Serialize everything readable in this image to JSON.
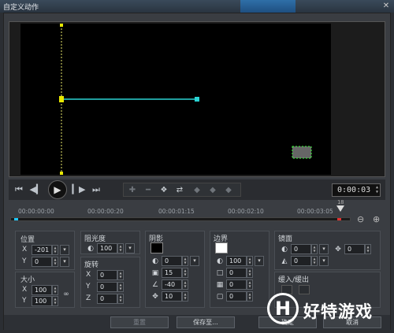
{
  "window": {
    "title": "自定义动作",
    "close_label": "✕"
  },
  "transport": {
    "icons": [
      "go-start-icon",
      "prev-frame-icon",
      "play-icon",
      "next-frame-icon",
      "go-end-icon"
    ],
    "glyphs": {
      "start": "⏮",
      "prev": "◀▎",
      "play": "▶",
      "next": "▎▶",
      "end": "⏭"
    }
  },
  "keyframes": {
    "glyphs": [
      "✚",
      "━",
      "❖",
      "⇄",
      "◆",
      "◆",
      "◆"
    ]
  },
  "timecode": {
    "value": "0:00:03",
    "frame": "18"
  },
  "ruler": {
    "ticks": [
      "00:00:00:00",
      "00:00:00:20",
      "00:00:01:15",
      "00:00:02:10",
      "00:00:03:05"
    ],
    "zoom_out": "⊖",
    "zoom_in": "⊕"
  },
  "position": {
    "label": "位置",
    "x_label": "X",
    "x": "-201",
    "y_label": "Y",
    "y": "0"
  },
  "size": {
    "label": "大小",
    "x_label": "X",
    "x": "100",
    "y_label": "Y",
    "y": "100",
    "link_icon": "∞"
  },
  "opacity": {
    "label": "阻光度",
    "value": "100"
  },
  "rotation": {
    "label": "旋转",
    "x_label": "X",
    "x": "0",
    "y_label": "Y",
    "y": "0",
    "z_label": "Z",
    "z": "0"
  },
  "shadow": {
    "label": "阴影",
    "color": "#000000",
    "v1": "0",
    "v2": "15",
    "v3": "-40",
    "v4": "10"
  },
  "border": {
    "label": "边界",
    "color": "#ffffff",
    "v1": "100",
    "v2": "0",
    "v3": "0",
    "v4": "0"
  },
  "mirror": {
    "label": "镜面",
    "v1": "0",
    "v2": "0",
    "v3": "0"
  },
  "fade": {
    "label": "缓入/缓出"
  },
  "buttons": {
    "reset": "重置",
    "save_to": "保存至...",
    "ok": "确定",
    "cancel": "取消"
  },
  "watermark": {
    "logo": "H",
    "text": "好特游戏"
  }
}
